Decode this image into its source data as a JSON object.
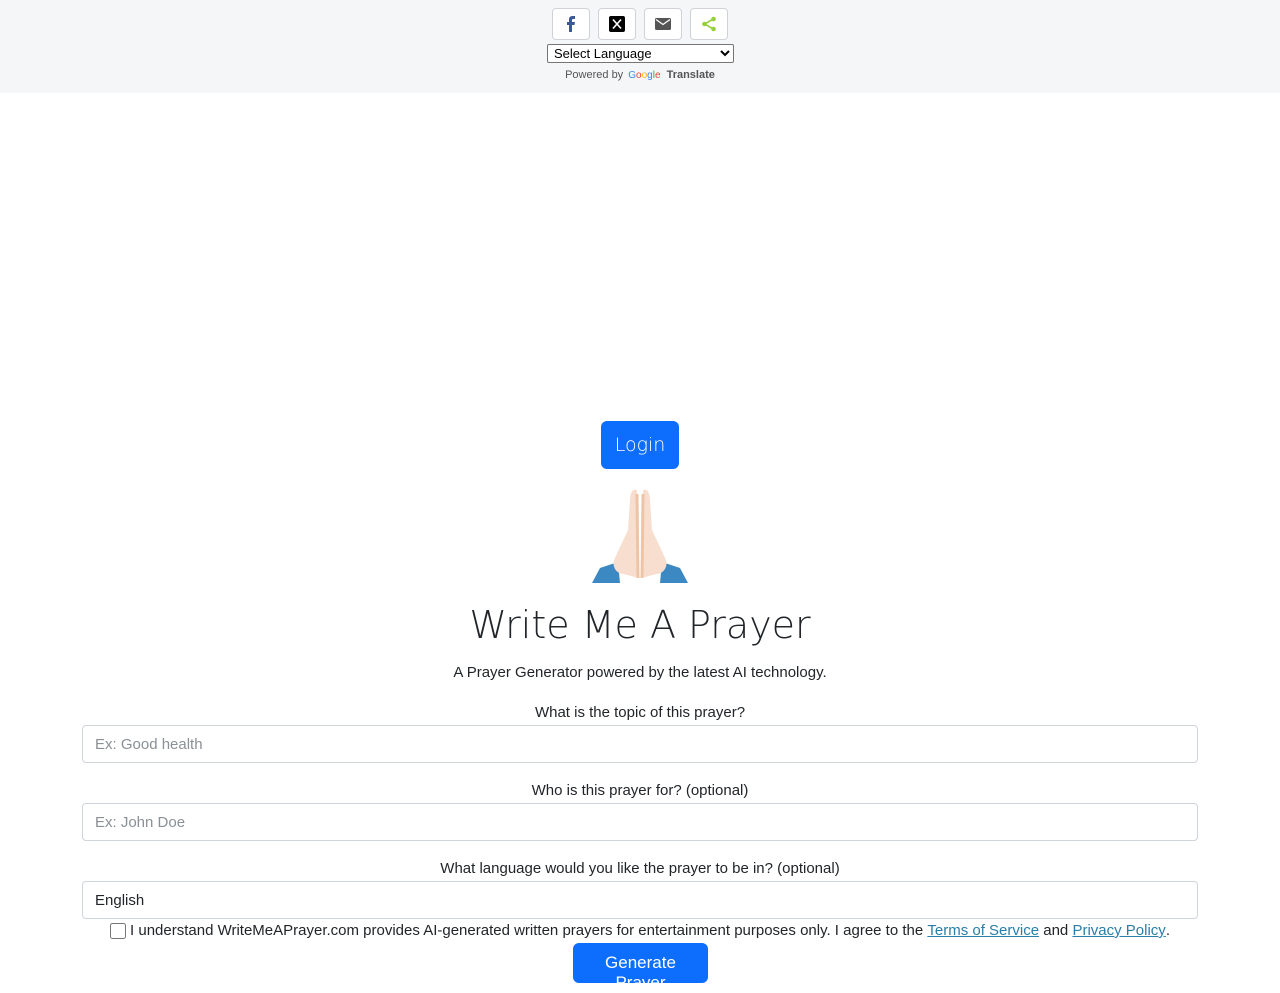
{
  "share": {
    "buttons": [
      {
        "name": "facebook",
        "color": "#3b5998"
      },
      {
        "name": "x",
        "color": "#000000"
      },
      {
        "name": "email",
        "color": "#555555"
      },
      {
        "name": "sharethis",
        "color": "#95d03a"
      }
    ]
  },
  "translate": {
    "select_label": "Select Language",
    "powered_by": "Powered by",
    "google": "Google",
    "translate": "Translate"
  },
  "login_label": "Login",
  "header": {
    "title": "Write Me A Prayer",
    "subtitle": "A Prayer Generator powered by the latest AI technology."
  },
  "form": {
    "topic_label": "What is the topic of this prayer?",
    "topic_placeholder": "Ex: Good health",
    "for_label": "Who is this prayer for? (optional)",
    "for_placeholder": "Ex: John Doe",
    "language_label": "What language would you like the prayer to be in? (optional)",
    "language_value": "English",
    "agree_text": "I understand WriteMeAPrayer.com provides AI-generated written prayers for entertainment purposes only. I agree to the",
    "terms_link": "Terms of Service",
    "and_text": "and",
    "privacy_link": "Privacy Policy",
    "period": ".",
    "submit_label": "Generate Prayer"
  },
  "colors": {
    "accent": "#0d6efd",
    "link": "#2a7ea8"
  }
}
